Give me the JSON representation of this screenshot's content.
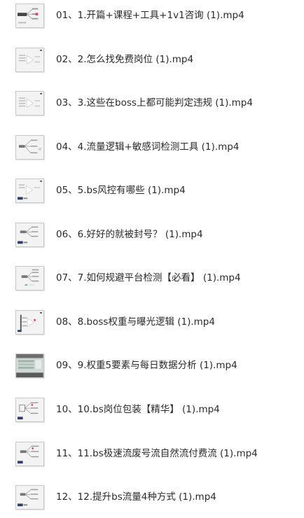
{
  "files": [
    {
      "name": "01、1.开篇+课程+工具+1v1咨询 (1).mp4",
      "thumb": "mindmap-pink-thumbnail-icon"
    },
    {
      "name": "02、2.怎么找免费岗位 (1).mp4",
      "thumb": "play-thumbnail-icon"
    },
    {
      "name": "03、3.这些在boss上都可能判定违规 (1).mp4",
      "thumb": "play-thumbnail-icon"
    },
    {
      "name": "04、4.流量逻辑+敏感词检测工具 (1).mp4",
      "thumb": "mindmap-thumbnail-icon"
    },
    {
      "name": "05、5.bs风控有哪些 (1).mp4",
      "thumb": "play-thumbnail-icon"
    },
    {
      "name": "06、6.好好的就被封号？ (1).mp4",
      "thumb": "mindmap-thumbnail-icon"
    },
    {
      "name": "07、7.如何规避平台检测【必看】 (1).mp4",
      "thumb": "mindmap-thumbnail-icon"
    },
    {
      "name": "08、8.boss权重与曝光逻辑 (1).mp4",
      "thumb": "play-thumbnail-icon"
    },
    {
      "name": "09、9.权重5要素与每日数据分析 (1).mp4",
      "thumb": "table-thumbnail-icon"
    },
    {
      "name": "10、10.bs岗位包装【精华】 (1).mp4",
      "thumb": "mindmap-thumbnail-icon"
    },
    {
      "name": "11、11.bs极速流废号流自然流付费流 (1).mp4",
      "thumb": "mindmap-thumbnail-icon"
    },
    {
      "name": "12、12.提升bs流量4种方式 (1).mp4",
      "thumb": "mindmap-thumbnail-icon"
    }
  ]
}
